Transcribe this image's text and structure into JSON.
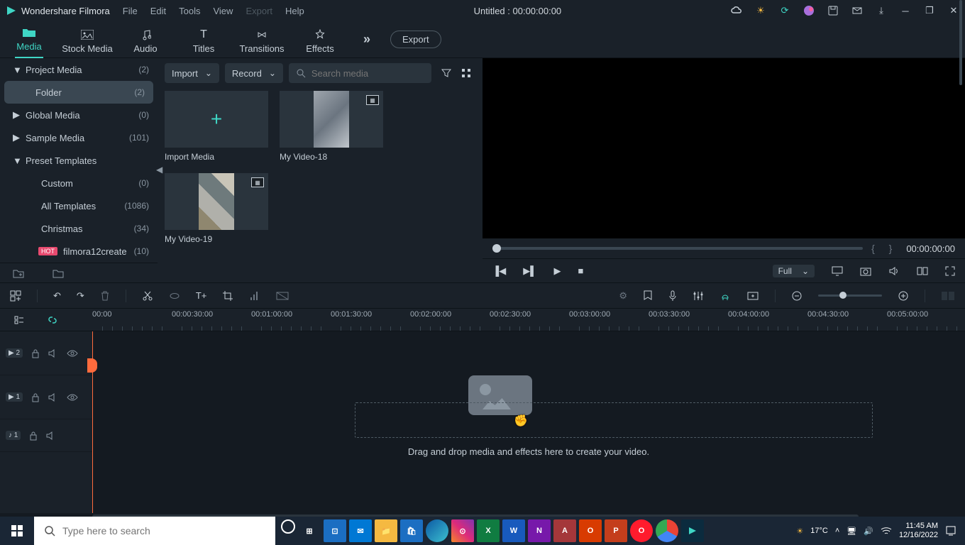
{
  "titlebar": {
    "app_name": "Wondershare Filmora",
    "menu": [
      "File",
      "Edit",
      "Tools",
      "View",
      "Export",
      "Help"
    ],
    "menu_disabled_index": 4,
    "project_title": "Untitled : 00:00:00:00"
  },
  "tabs": [
    {
      "label": "Media",
      "active": true
    },
    {
      "label": "Stock Media"
    },
    {
      "label": "Audio"
    },
    {
      "label": "Titles"
    },
    {
      "label": "Transitions"
    },
    {
      "label": "Effects"
    }
  ],
  "export_label": "Export",
  "sidebar": {
    "items": [
      {
        "label": "Project Media",
        "count": "(2)",
        "arrow": "▼"
      },
      {
        "label": "Folder",
        "count": "(2)",
        "selected": true,
        "indent": true
      },
      {
        "label": "Global Media",
        "count": "(0)",
        "arrow": "▶"
      },
      {
        "label": "Sample Media",
        "count": "(101)",
        "arrow": "▶"
      },
      {
        "label": "Preset Templates",
        "count": "",
        "arrow": "▼"
      },
      {
        "label": "Custom",
        "count": "(0)",
        "indent2": true
      },
      {
        "label": "All Templates",
        "count": "(1086)",
        "indent2": true
      },
      {
        "label": "Christmas",
        "count": "(34)",
        "indent2": true
      },
      {
        "label": "filmora12create",
        "count": "(10)",
        "indent2": true,
        "hot": true
      }
    ]
  },
  "media_toolbar": {
    "import": "Import",
    "record": "Record",
    "search_placeholder": "Search media"
  },
  "media_items": [
    {
      "type": "import",
      "label": "Import Media"
    },
    {
      "type": "video",
      "label": "My Video-18",
      "img": "imgph"
    },
    {
      "type": "video",
      "label": "My Video-19",
      "img": "imgph2"
    }
  ],
  "preview": {
    "brackets": "{      }",
    "timecode": "00:00:00:00",
    "quality": "Full"
  },
  "timeline": {
    "ruler_labels": [
      "00:00",
      "00:00:30:00",
      "00:01:00:00",
      "00:01:30:00",
      "00:02:00:00",
      "00:02:30:00",
      "00:03:00:00",
      "00:03:30:00",
      "00:04:00:00",
      "00:04:30:00",
      "00:05:00:00"
    ],
    "track2_badge": "▶ 2",
    "track1_badge": "▶ 1",
    "audio_badge": "♪ 1",
    "drop_text": "Drag and drop media and effects here to create your video."
  },
  "taskbar": {
    "search_placeholder": "Type here to search",
    "weather": "17°C",
    "time": "11:45 AM",
    "date": "12/16/2022"
  }
}
